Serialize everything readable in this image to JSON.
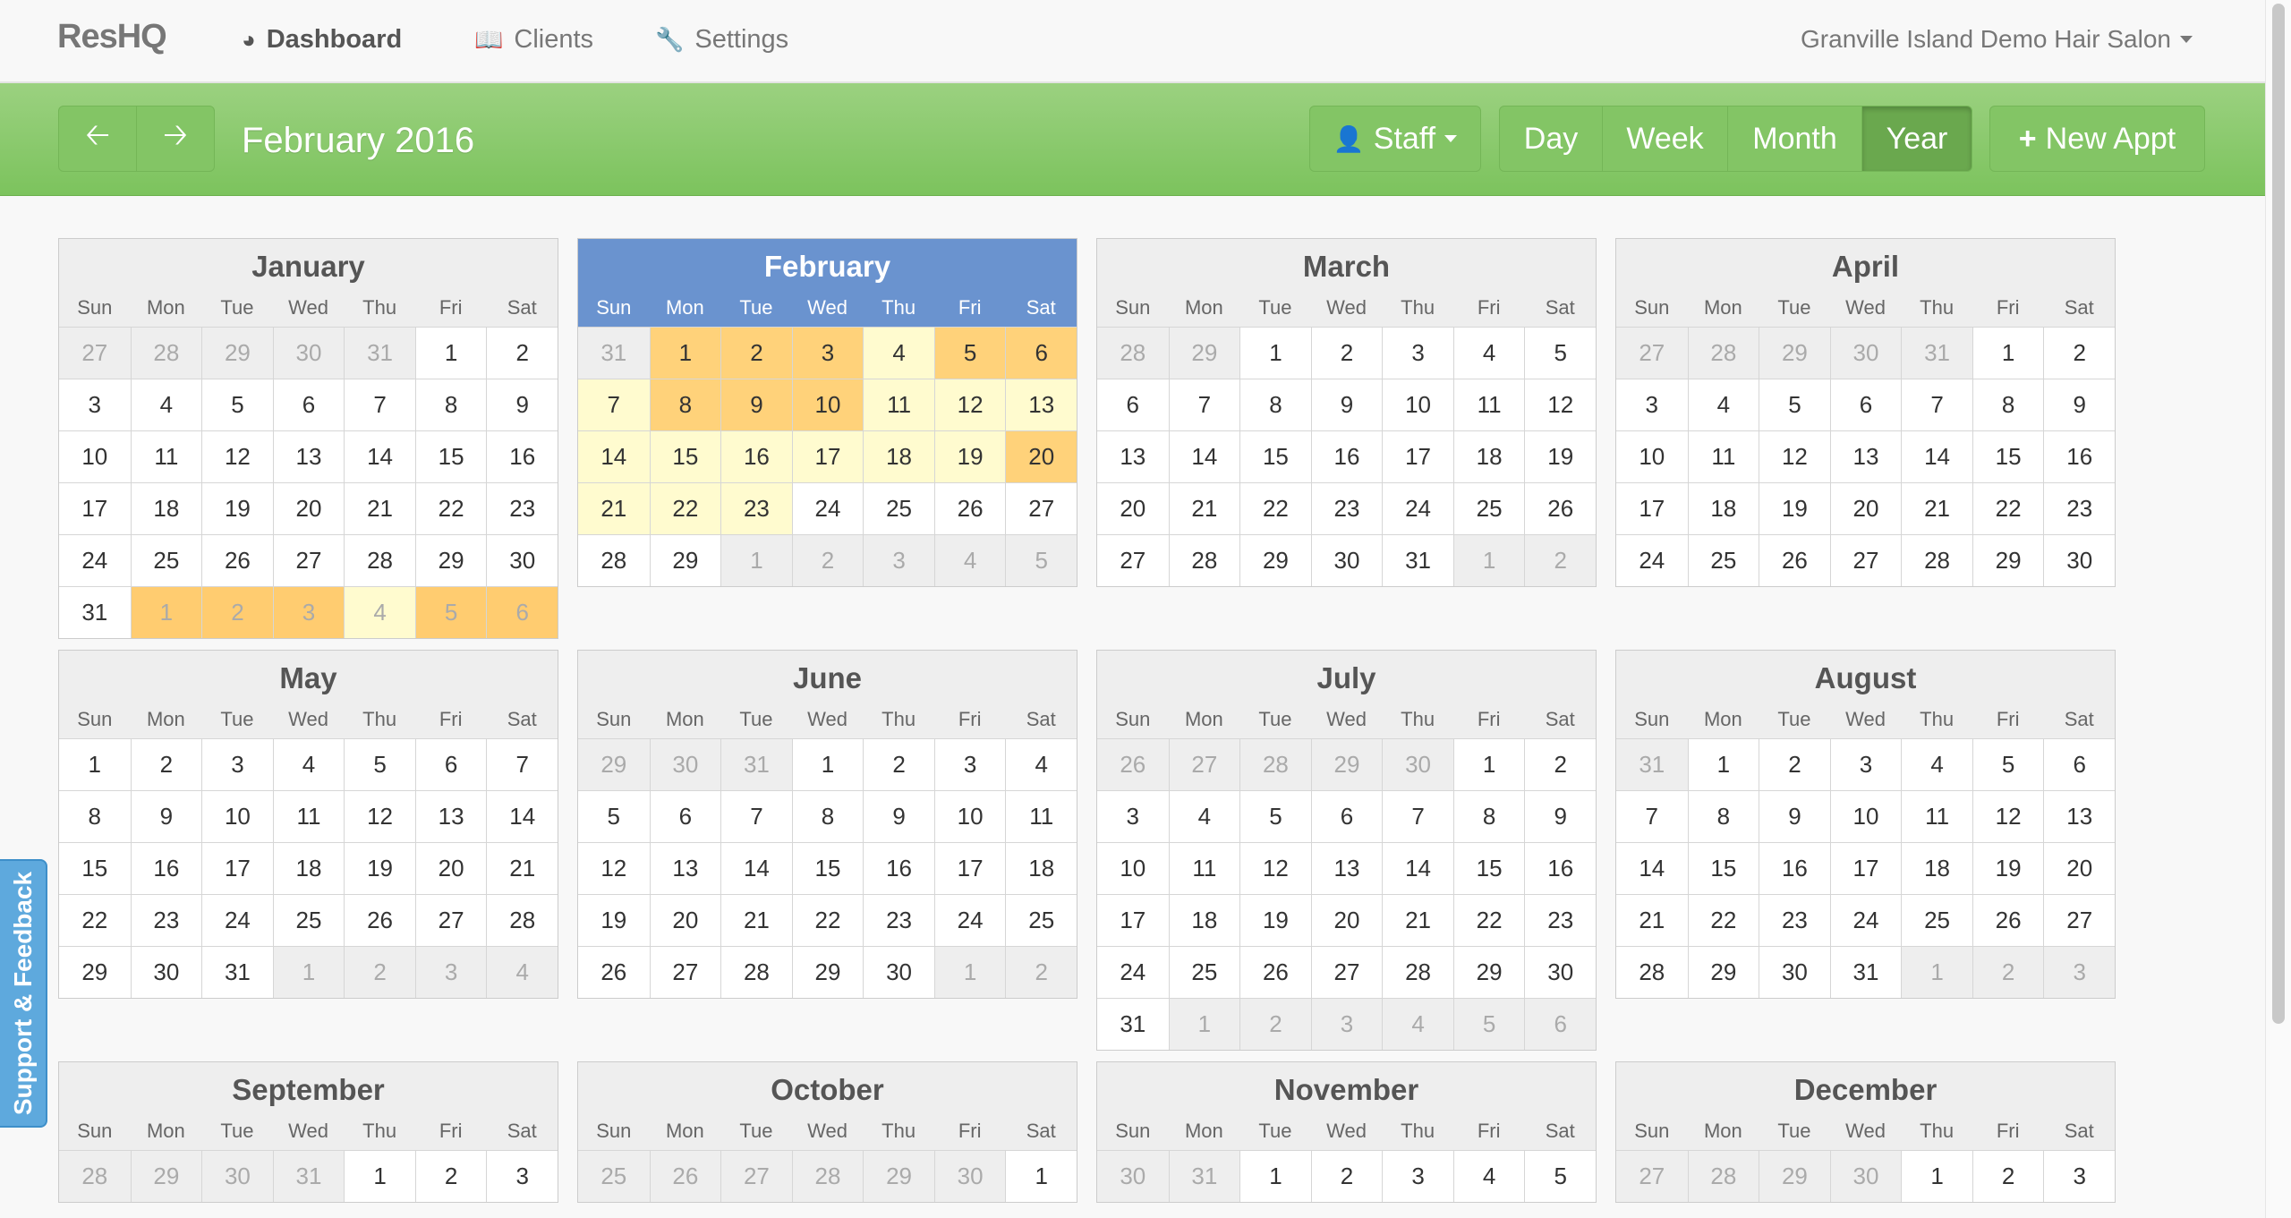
{
  "nav": {
    "brand": "ResHQ",
    "items": [
      {
        "label": "Dashboard",
        "icon": "dashboard-icon"
      },
      {
        "label": "Clients",
        "icon": "book-icon"
      },
      {
        "label": "Settings",
        "icon": "wrench-icon"
      }
    ],
    "account": "Granville Island Demo Hair Salon"
  },
  "toolbar": {
    "title": "February 2016",
    "staff": "Staff",
    "views": [
      "Day",
      "Week",
      "Month",
      "Year"
    ],
    "active_view": "Year",
    "new_appt": "New Appt"
  },
  "feedback": "Support & Feedback",
  "calendar": {
    "dow": [
      "Sun",
      "Mon",
      "Tue",
      "Wed",
      "Thu",
      "Fri",
      "Sat"
    ],
    "current_month": "February",
    "months": [
      {
        "name": "January",
        "weeks": [
          [
            "27",
            "28",
            "29",
            "30",
            "31",
            "1",
            "2"
          ],
          [
            "3",
            "4",
            "5",
            "6",
            "7",
            "8",
            "9"
          ],
          [
            "10",
            "11",
            "12",
            "13",
            "14",
            "15",
            "16"
          ],
          [
            "17",
            "18",
            "19",
            "20",
            "21",
            "22",
            "23"
          ],
          [
            "24",
            "25",
            "26",
            "27",
            "28",
            "29",
            "30"
          ],
          [
            "31",
            "1",
            "2",
            "3",
            "4",
            "5",
            "6"
          ]
        ],
        "lead": 5,
        "trail": 6,
        "highlights": {
          "36": 3,
          "37": 3,
          "38": 3,
          "39": 1,
          "40": 3,
          "41": 3
        }
      },
      {
        "name": "February",
        "weeks": [
          [
            "31",
            "1",
            "2",
            "3",
            "4",
            "5",
            "6"
          ],
          [
            "7",
            "8",
            "9",
            "10",
            "11",
            "12",
            "13"
          ],
          [
            "14",
            "15",
            "16",
            "17",
            "18",
            "19",
            "20"
          ],
          [
            "21",
            "22",
            "23",
            "24",
            "25",
            "26",
            "27"
          ],
          [
            "28",
            "29",
            "1",
            "2",
            "3",
            "4",
            "5"
          ]
        ],
        "lead": 1,
        "trail": 5,
        "highlights": {
          "1": 2,
          "2": 2,
          "3": 2,
          "4": 1,
          "5": 2,
          "6": 2,
          "7": 1,
          "8": 2,
          "9": 2,
          "10": 2,
          "11": 1,
          "12": 1,
          "13": 1,
          "14": 1,
          "15": 1,
          "16": 1,
          "17": 1,
          "18": 1,
          "19": 1,
          "20": 2,
          "21": 1,
          "22": 1,
          "23": 1
        }
      },
      {
        "name": "March",
        "weeks": [
          [
            "28",
            "29",
            "1",
            "2",
            "3",
            "4",
            "5"
          ],
          [
            "6",
            "7",
            "8",
            "9",
            "10",
            "11",
            "12"
          ],
          [
            "13",
            "14",
            "15",
            "16",
            "17",
            "18",
            "19"
          ],
          [
            "20",
            "21",
            "22",
            "23",
            "24",
            "25",
            "26"
          ],
          [
            "27",
            "28",
            "29",
            "30",
            "31",
            "1",
            "2"
          ]
        ],
        "lead": 2,
        "trail": 2
      },
      {
        "name": "April",
        "weeks": [
          [
            "27",
            "28",
            "29",
            "30",
            "31",
            "1",
            "2"
          ],
          [
            "3",
            "4",
            "5",
            "6",
            "7",
            "8",
            "9"
          ],
          [
            "10",
            "11",
            "12",
            "13",
            "14",
            "15",
            "16"
          ],
          [
            "17",
            "18",
            "19",
            "20",
            "21",
            "22",
            "23"
          ],
          [
            "24",
            "25",
            "26",
            "27",
            "28",
            "29",
            "30"
          ]
        ],
        "lead": 5,
        "trail": 0
      },
      {
        "name": "May",
        "weeks": [
          [
            "1",
            "2",
            "3",
            "4",
            "5",
            "6",
            "7"
          ],
          [
            "8",
            "9",
            "10",
            "11",
            "12",
            "13",
            "14"
          ],
          [
            "15",
            "16",
            "17",
            "18",
            "19",
            "20",
            "21"
          ],
          [
            "22",
            "23",
            "24",
            "25",
            "26",
            "27",
            "28"
          ],
          [
            "29",
            "30",
            "31",
            "1",
            "2",
            "3",
            "4"
          ]
        ],
        "lead": 0,
        "trail": 4
      },
      {
        "name": "June",
        "weeks": [
          [
            "29",
            "30",
            "31",
            "1",
            "2",
            "3",
            "4"
          ],
          [
            "5",
            "6",
            "7",
            "8",
            "9",
            "10",
            "11"
          ],
          [
            "12",
            "13",
            "14",
            "15",
            "16",
            "17",
            "18"
          ],
          [
            "19",
            "20",
            "21",
            "22",
            "23",
            "24",
            "25"
          ],
          [
            "26",
            "27",
            "28",
            "29",
            "30",
            "1",
            "2"
          ]
        ],
        "lead": 3,
        "trail": 2
      },
      {
        "name": "July",
        "weeks": [
          [
            "26",
            "27",
            "28",
            "29",
            "30",
            "1",
            "2"
          ],
          [
            "3",
            "4",
            "5",
            "6",
            "7",
            "8",
            "9"
          ],
          [
            "10",
            "11",
            "12",
            "13",
            "14",
            "15",
            "16"
          ],
          [
            "17",
            "18",
            "19",
            "20",
            "21",
            "22",
            "23"
          ],
          [
            "24",
            "25",
            "26",
            "27",
            "28",
            "29",
            "30"
          ],
          [
            "31",
            "1",
            "2",
            "3",
            "4",
            "5",
            "6"
          ]
        ],
        "lead": 5,
        "trail": 6
      },
      {
        "name": "August",
        "weeks": [
          [
            "31",
            "1",
            "2",
            "3",
            "4",
            "5",
            "6"
          ],
          [
            "7",
            "8",
            "9",
            "10",
            "11",
            "12",
            "13"
          ],
          [
            "14",
            "15",
            "16",
            "17",
            "18",
            "19",
            "20"
          ],
          [
            "21",
            "22",
            "23",
            "24",
            "25",
            "26",
            "27"
          ],
          [
            "28",
            "29",
            "30",
            "31",
            "1",
            "2",
            "3"
          ]
        ],
        "lead": 1,
        "trail": 3
      },
      {
        "name": "September",
        "weeks": [
          [
            "28",
            "29",
            "30",
            "31",
            "1",
            "2",
            "3"
          ]
        ],
        "lead": 4,
        "trail": 0
      },
      {
        "name": "October",
        "weeks": [
          [
            "25",
            "26",
            "27",
            "28",
            "29",
            "30",
            "1"
          ]
        ],
        "lead": 6,
        "trail": 0
      },
      {
        "name": "November",
        "weeks": [
          [
            "30",
            "31",
            "1",
            "2",
            "3",
            "4",
            "5"
          ]
        ],
        "lead": 2,
        "trail": 0
      },
      {
        "name": "December",
        "weeks": [
          [
            "27",
            "28",
            "29",
            "30",
            "1",
            "2",
            "3"
          ]
        ],
        "lead": 4,
        "trail": 0
      }
    ]
  }
}
